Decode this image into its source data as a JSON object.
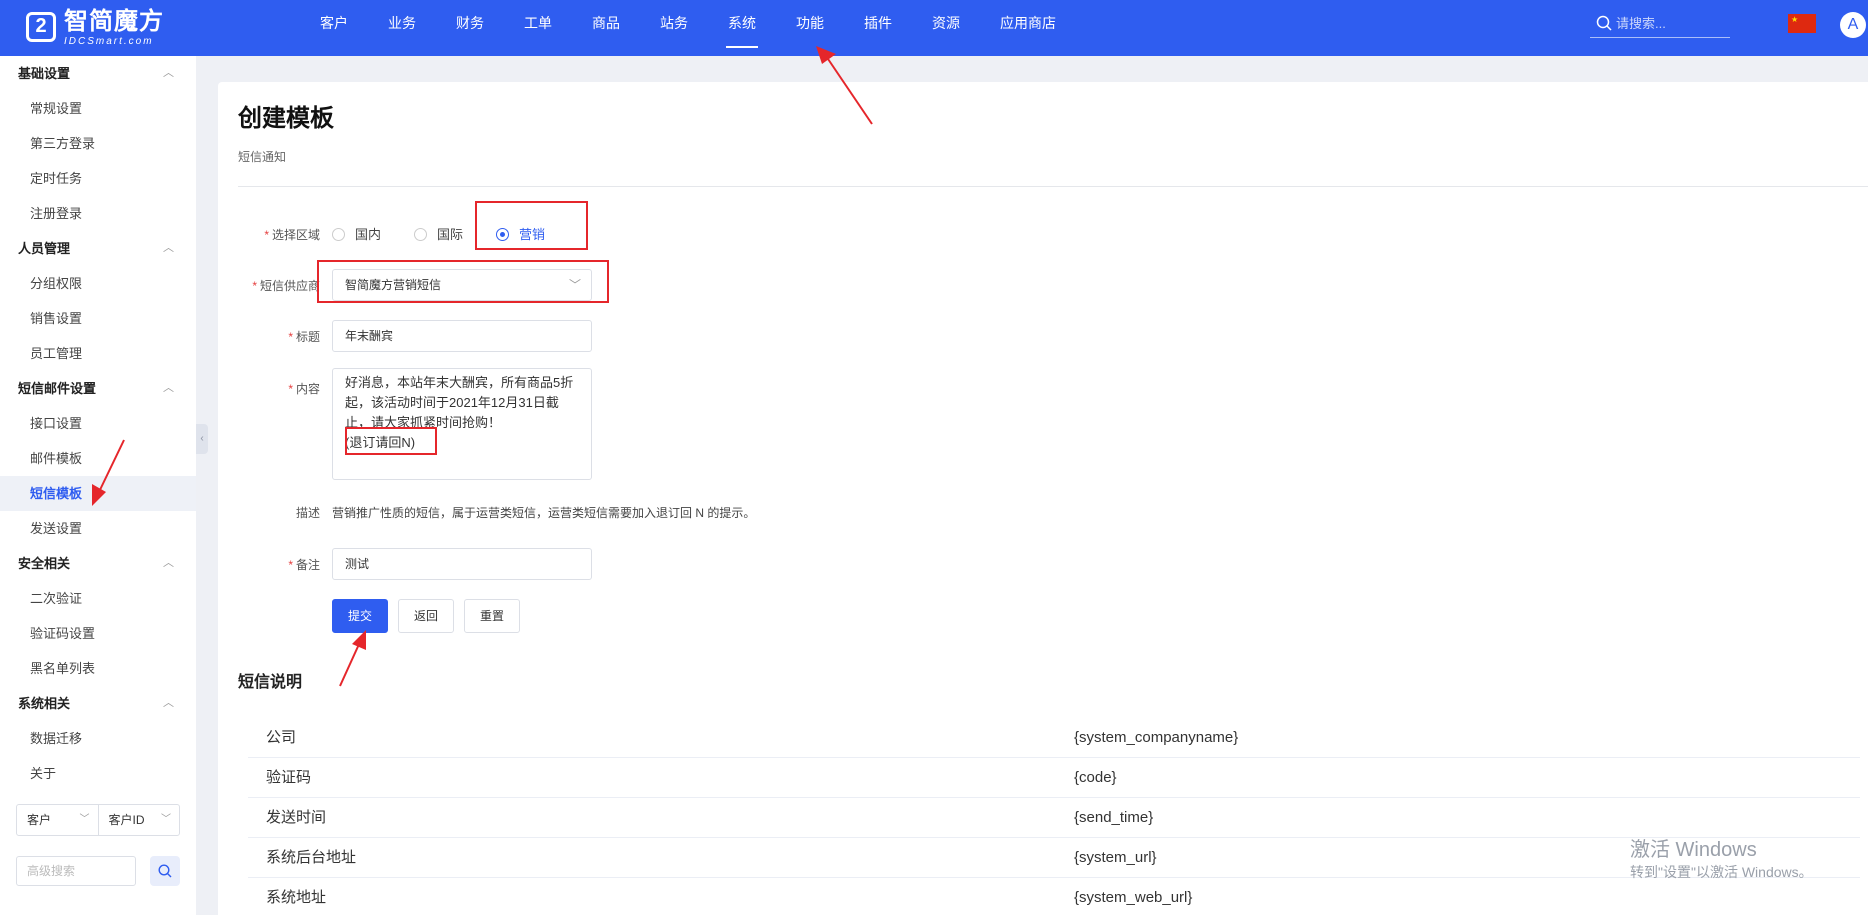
{
  "topbar": {
    "logo_text": "智简魔方",
    "logo_sub": "IDCSmart.com",
    "nav": [
      "客户",
      "业务",
      "财务",
      "工单",
      "商品",
      "站务",
      "系统",
      "功能",
      "插件",
      "资源",
      "应用商店"
    ],
    "active_nav": "系统",
    "search_placeholder": "请搜索...",
    "avatar_letter": "A"
  },
  "sidebar": {
    "groups": [
      {
        "title": "基础设置",
        "items": [
          "常规设置",
          "第三方登录",
          "定时任务",
          "注册登录"
        ]
      },
      {
        "title": "人员管理",
        "items": [
          "分组权限",
          "销售设置",
          "员工管理"
        ]
      },
      {
        "title": "短信邮件设置",
        "items": [
          "接口设置",
          "邮件模板",
          "短信模板",
          "发送设置"
        ]
      },
      {
        "title": "安全相关",
        "items": [
          "二次验证",
          "验证码设置",
          "黑名单列表"
        ]
      },
      {
        "title": "系统相关",
        "items": [
          "数据迁移",
          "关于"
        ]
      }
    ],
    "active_item": "短信模板",
    "filter_type": "客户",
    "filter_field": "客户ID",
    "advanced_search_placeholder": "高级搜索"
  },
  "main": {
    "title": "创建模板",
    "subtitle": "短信通知",
    "form": {
      "region_label": "选择区域",
      "regions": [
        "国内",
        "国际",
        "营销"
      ],
      "selected_region": "营销",
      "provider_label": "短信供应商",
      "provider_value": "智简魔方营销短信",
      "title_label": "标题",
      "title_value": "年末酬宾",
      "content_label": "内容",
      "content_value": "好消息，本站年末大酬宾，所有商品5折起，该活动时间于2021年12月31日截止，请大家抓紧时间抢购！",
      "content_suffix": "(退订请回N)",
      "desc_label": "描述",
      "desc_value": "营销推广性质的短信，属于运营类短信，运营类短信需要加入退订回 N 的提示。",
      "note_label": "备注",
      "note_value": "测试"
    },
    "buttons": {
      "submit": "提交",
      "back": "返回",
      "reset": "重置"
    },
    "vars_title": "短信说明",
    "vars": [
      {
        "name": "公司",
        "code": "{system_companyname}"
      },
      {
        "name": "验证码",
        "code": "{code}"
      },
      {
        "name": "发送时间",
        "code": "{send_time}"
      },
      {
        "name": "系统后台地址",
        "code": "{system_url}"
      },
      {
        "name": "系统地址",
        "code": "{system_web_url}"
      }
    ]
  },
  "watermark": {
    "line1": "激活 Windows",
    "line2": "转到\"设置\"以激活 Windows。"
  },
  "colors": {
    "brand": "#2f5df0",
    "annotation": "#e5262b",
    "required": "#e53e3e"
  }
}
